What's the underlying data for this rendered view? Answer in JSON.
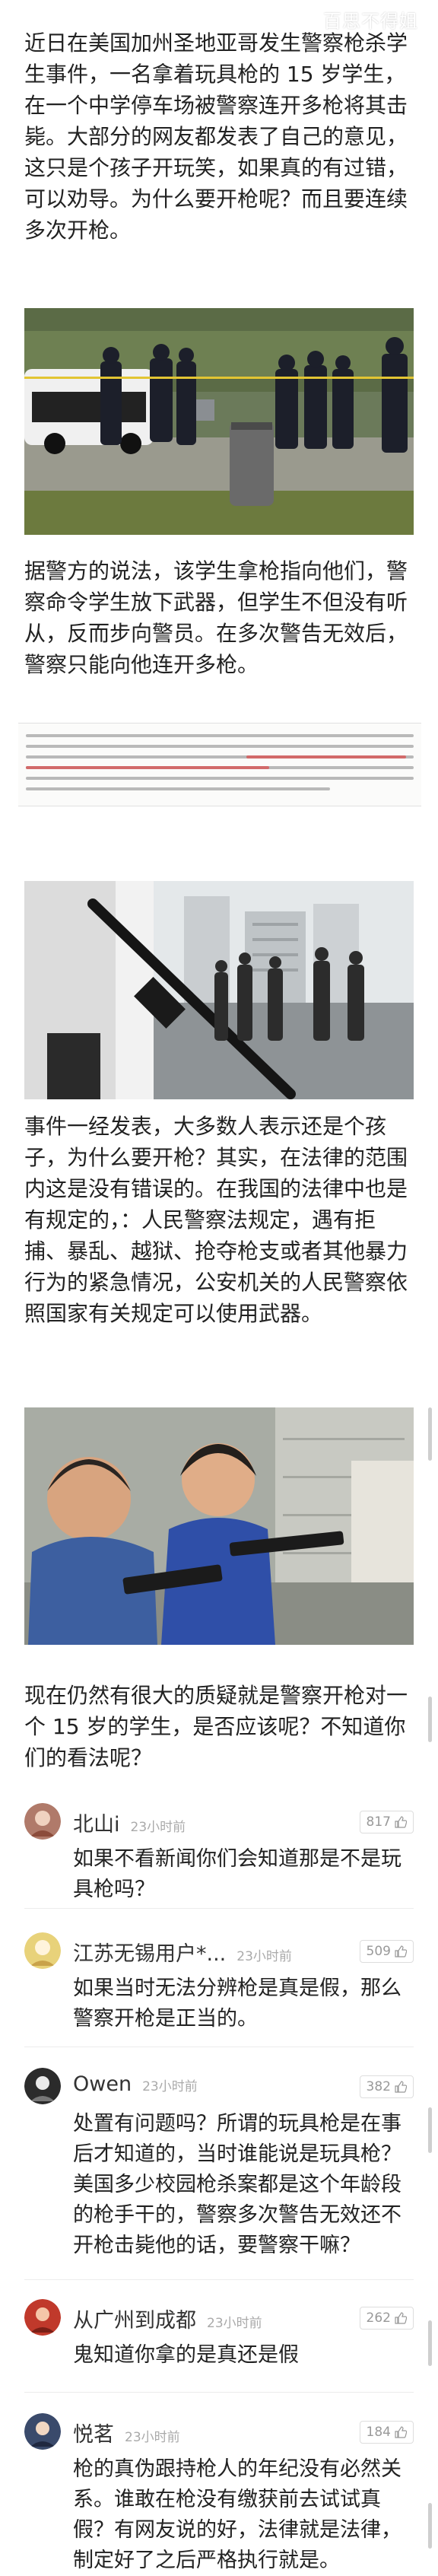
{
  "watermark": "百思不得姐",
  "article": {
    "p1": "近日在美国加州圣地亚哥发生警察枪杀学生事件，一名拿着玩具枪的 15 岁学生，在一个中学停车场被警察连开多枪将其击毙。大部分的网友都发表了自己的意见，这只是个孩子开玩笑，如果真的有过错，可以劝导。为什么要开枪呢？而且要连续多次开枪。",
    "p2": "据警方的说法，该学生拿枪指向他们，警察命令学生放下武器，但学生不但没有听从，反而步向警员。在多次警告无效后，警察只能向他连开多枪。",
    "p3": "事件一经发表，大多数人表示还是个孩子，为什么要开枪？其实，在法律的范围内这是没有错误的。在我国的法律中也是有规定的，：人民警察法规定，遇有拒捕、暴乱、越狱、抢夺枪支或者其他暴力行为的紧急情况，公安机关的人民警察依照国家有关规定可以使用武器。",
    "p4": "现在仍然有很大的质疑就是警察开枪对一个 15 岁的学生，是否应该呢？不知道你们的看法呢？"
  },
  "comments": [
    {
      "name": "北山i",
      "time": "23小时前",
      "likes": "817",
      "text": "如果不看新闻你们会知道那是不是玩具枪吗？",
      "avatar_color": "#b07a6a"
    },
    {
      "name": "江苏无锡用户*...",
      "time": "23小时前",
      "likes": "509",
      "text": "如果当时无法分辨枪是真是假，那么警察开枪是正当的。",
      "avatar_color": "#e8d27a"
    },
    {
      "name": "Owen",
      "time": "23小时前",
      "likes": "382",
      "text": "处置有问题吗？所谓的玩具枪是在事后才知道的，当时谁能说是玩具枪？美国多少校园枪杀案都是这个年龄段的枪手干的，警察多次警告无效还不开枪击毙他的话，要警察干嘛？",
      "avatar_color": "#2b2b2b"
    },
    {
      "name": "从广州到成都",
      "time": "23小时前",
      "likes": "262",
      "text": "鬼知道你拿的是真还是假",
      "avatar_color": "#c0392b"
    },
    {
      "name": "悦茗",
      "time": "23小时前",
      "likes": "184",
      "text": "枪的真伪跟持枪人的年纪没有必然关系。谁敢在枪没有缴获前去试试真假？有网友说的好，法律就是法律，制定好了之后严格执行就是。",
      "avatar_color": "#3a4a6b"
    }
  ]
}
